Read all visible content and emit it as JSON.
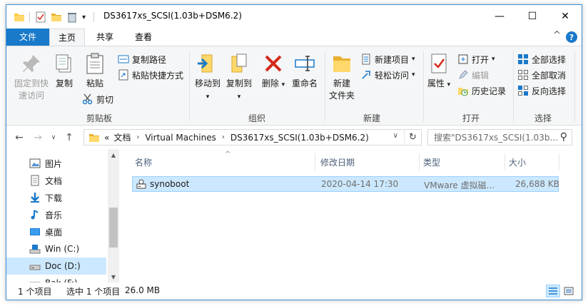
{
  "window": {
    "title": "DS3617xs_SCSI(1.03b+DSM6.2)",
    "accent_color": "#1979ca",
    "minimize_glyph": "—",
    "maximize_glyph": "☐",
    "close_glyph": "✕"
  },
  "quick_access": {
    "customize_glyph": "▾"
  },
  "ribbon_tabs": {
    "file": "文件",
    "home": "主页",
    "share": "共享",
    "view": "查看",
    "active": "主页"
  },
  "ribbon": {
    "clipboard": {
      "label": "剪贴板",
      "pin_quick_access": "固定到快\n速访问",
      "pin_line1": "固定到快",
      "pin_line2": "速访问",
      "copy": "复制",
      "paste": "粘贴",
      "copy_path": "复制路径",
      "paste_shortcut": "粘贴快捷方式",
      "cut": "剪切"
    },
    "organize": {
      "label": "组织",
      "move_to": "移动到",
      "copy_to": "复制到",
      "delete": "删除",
      "rename": "重命名",
      "dropdown_glyph": "▾"
    },
    "new": {
      "label": "新建",
      "new_folder_line1": "新建",
      "new_folder_line2": "文件夹",
      "new_item": "新建项目",
      "easy_access": "轻松访问"
    },
    "open": {
      "label": "打开",
      "properties": "属性",
      "open": "打开",
      "edit": "编辑",
      "history": "历史记录"
    },
    "select": {
      "label": "选择",
      "select_all": "全部选择",
      "select_none": "全部取消",
      "invert": "反向选择"
    },
    "collapse_glyph": "^",
    "help_glyph": "?"
  },
  "navigation": {
    "back_glyph": "←",
    "forward_glyph": "→",
    "recent_glyph": "∨",
    "up_glyph": "↑",
    "breadcrumb_overflow": "«",
    "breadcrumb": [
      "文档",
      "Virtual Machines",
      "DS3617xs_SCSI(1.03b+DSM6.2)"
    ],
    "crumb_sep": "›",
    "dropdown_glyph": "∨",
    "refresh_glyph": "↻",
    "search_placeholder": "搜索\"DS3617xs_SCSI(1.03b...",
    "search_glyph": "⚲"
  },
  "nav_pane": {
    "items": [
      {
        "label": "图片",
        "icon": "pictures-icon"
      },
      {
        "label": "文档",
        "icon": "documents-icon"
      },
      {
        "label": "下载",
        "icon": "downloads-icon"
      },
      {
        "label": "音乐",
        "icon": "music-icon"
      },
      {
        "label": "桌面",
        "icon": "desktop-icon"
      },
      {
        "label": "Win (C:)",
        "icon": "drive-icon"
      },
      {
        "label": "Doc (D:)",
        "icon": "drive-icon"
      },
      {
        "label": "Bak (F:)",
        "icon": "drive-icon"
      }
    ],
    "selected": "Doc (D:)",
    "scroll_up_glyph": "▲",
    "scroll_down_glyph": "▼"
  },
  "file_list": {
    "columns": [
      "名称",
      "修改日期",
      "类型",
      "大小"
    ],
    "sort_glyph": "^",
    "rows": [
      {
        "name": "synoboot",
        "modified": "2020-04-14 17:30",
        "type": "VMware 虚拟磁...",
        "size": "26,688 KB",
        "icon": "vmdk-disk-icon"
      }
    ]
  },
  "status_bar": {
    "count": "1 个项目",
    "selected": "选中 1 个项目",
    "size": "26.0 MB"
  }
}
